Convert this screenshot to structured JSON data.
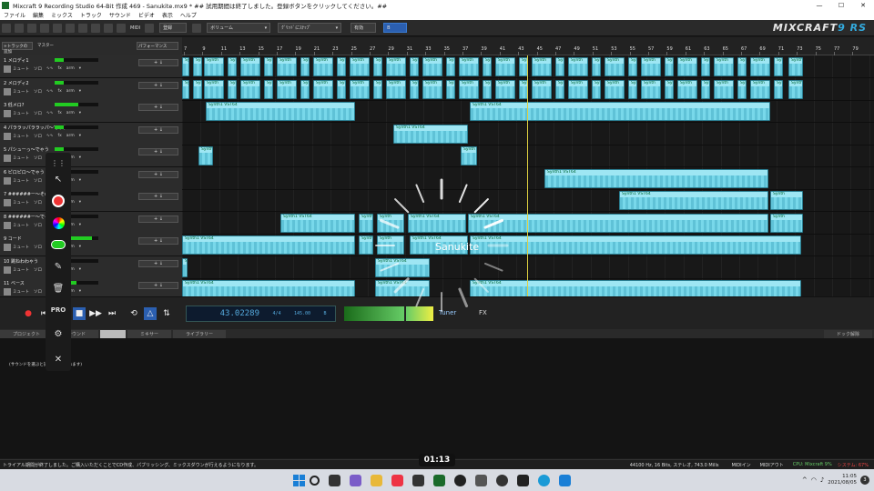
{
  "window": {
    "title": "Mixcraft 9 Recording Studio 64-Bit 作成 469 - Sanukite.mx9 *  ## 試用期間は終了しました。登録ボタンをクリックしてください。##",
    "min": "—",
    "max": "☐",
    "close": "✕"
  },
  "menu": [
    "ファイル",
    "編集",
    "ミックス",
    "トラック",
    "サウンド",
    "ビデオ",
    "表示",
    "ヘルプ"
  ],
  "toolbar": {
    "midi_label": "MIDI",
    "register_label": "登録",
    "volume_label": "ボリューム",
    "snap_label": "ｸﾞﾘｯﾄﾞにｽﾅｯﾌﾟ",
    "btn_a": "有効",
    "btn_b": "B",
    "brand_main": "MIXCRAFT",
    "brand_accent": "9 RS"
  },
  "track_header_top": {
    "add_track": "+トラックの追加",
    "master": "マスター",
    "performance": "パフォーマンス"
  },
  "ruler": [
    "7",
    "9",
    "11",
    "13",
    "15",
    "17",
    "19",
    "21",
    "23",
    "25",
    "27",
    "29",
    "31",
    "33",
    "35",
    "37",
    "39",
    "41",
    "43",
    "45",
    "47",
    "49",
    "51",
    "53",
    "55",
    "57",
    "59",
    "61",
    "63",
    "65",
    "67",
    "69",
    "71",
    "73",
    "75",
    "77",
    "79"
  ],
  "tracks": [
    {
      "name": "1 メロディ1",
      "level": 0.2
    },
    {
      "name": "2 メロディ2",
      "level": 0.2
    },
    {
      "name": "3 低メロ?",
      "level": 0.55
    },
    {
      "name": "4 パララッパララッパ〜でゃう",
      "level": 0.2
    },
    {
      "name": "5 パシューっ〜でゃう",
      "level": 0.2
    },
    {
      "name": "6 ピロピロ〜でゃう",
      "level": 0.2
    },
    {
      "name": "7 ######ー〜その2",
      "level": 0.2
    },
    {
      "name": "8 ######ー〜でゃう",
      "level": 0.2
    },
    {
      "name": "9 コード",
      "level": 0.85
    },
    {
      "name": "10 跳ねわわゃう",
      "level": 0.2
    },
    {
      "name": "11 ベース",
      "level": 0.5
    }
  ],
  "track_controls": {
    "mute": "ミュート",
    "solo": "ソロ",
    "fx": "fx",
    "arm": "arm",
    "add": "+ ↓"
  },
  "clip_label": "Synth1 VST64",
  "clip_label_short": "Synth",
  "transport": {
    "time": "43.02289",
    "meter": "4/4",
    "tempo": "145.00",
    "key": "B",
    "tuner": "Tuner",
    "fx": "FX"
  },
  "tabs": [
    "プロジェクト",
    "サウンド",
    "",
    "ミキサー",
    "ライブラリー"
  ],
  "tabs_right": "ドック解除",
  "panel_hint": "(サウンドを選ぶと詳細が表示されます)",
  "overlay": {
    "pro": "PRO",
    "timer": "01:13",
    "loading_text": "Sanukite"
  },
  "status": {
    "left": "トライアル期間が終了しました。ご購入いただくことでCD作成、パブリッシング、ミックスダウンが行えるようになります。",
    "audio": "44100 Hz, 16 Bits, ステレオ, 743.0 Mills",
    "midi_in": "MIDIイン",
    "midi_out": "MIDIアウト",
    "cpu": "CPU: Mixcraft 9%",
    "system": "システム: 67%"
  },
  "taskbar": {
    "time": "11:05",
    "date": "2021/08/05",
    "badge": "3"
  }
}
